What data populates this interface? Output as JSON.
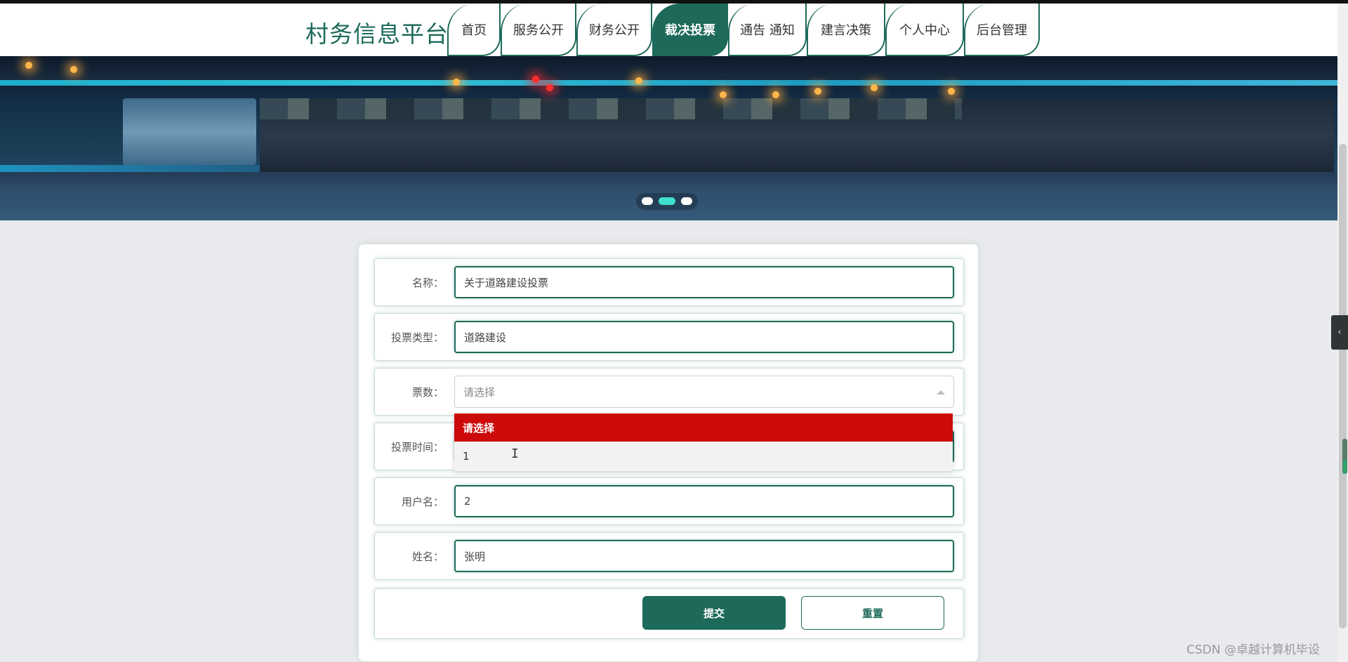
{
  "header": {
    "title": "村务信息平台",
    "nav": [
      {
        "label": "首页"
      },
      {
        "label": "服务公开"
      },
      {
        "label": "财务公开"
      },
      {
        "label": "裁决投票",
        "active": true
      },
      {
        "label": "通告 通知"
      },
      {
        "label": "建言决策"
      },
      {
        "label": "个人中心"
      },
      {
        "label": "后台管理"
      }
    ]
  },
  "banner": {
    "slides": 3,
    "active_slide": 2
  },
  "form": {
    "name": {
      "label": "名称：",
      "value": "关于道路建设投票"
    },
    "vote_type": {
      "label": "投票类型：",
      "value": "道路建设"
    },
    "votes": {
      "label": "票数：",
      "placeholder": "请选择"
    },
    "vote_time": {
      "label": "投票时间："
    },
    "username": {
      "label": "用户名：",
      "value": "2"
    },
    "realname": {
      "label": "姓名：",
      "value": "张明"
    },
    "dropdown_options": [
      "请选择",
      "1"
    ],
    "submit_label": "提交",
    "reset_label": "重置"
  },
  "sidetab_icon": "chevron-left-icon",
  "watermark": "CSDN @卓越计算机毕设",
  "colors": {
    "primary": "#1d6a5a",
    "dropdown_highlight": "#cc0a0a"
  }
}
